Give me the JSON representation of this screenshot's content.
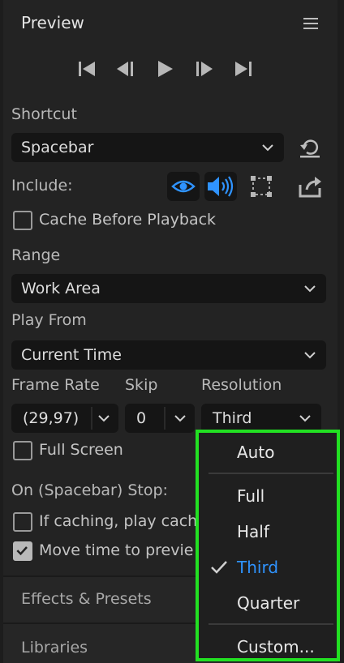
{
  "panel": {
    "title": "Preview"
  },
  "shortcut": {
    "label": "Shortcut",
    "value": "Spacebar"
  },
  "include": {
    "label": "Include:"
  },
  "cache_before_playback": {
    "label": "Cache Before Playback",
    "checked": false
  },
  "range": {
    "label": "Range",
    "value": "Work Area"
  },
  "play_from": {
    "label": "Play From",
    "value": "Current Time"
  },
  "frame_rate": {
    "label": "Frame Rate",
    "value": "(29,97)"
  },
  "skip": {
    "label": "Skip",
    "value": "0"
  },
  "resolution": {
    "label": "Resolution",
    "value": "Third",
    "menu": [
      "Auto",
      "Full",
      "Half",
      "Third",
      "Quarter",
      "Custom..."
    ],
    "selected": "Third"
  },
  "full_screen": {
    "label": "Full Screen",
    "checked": false
  },
  "on_stop": {
    "label": "On (Spacebar) Stop:",
    "if_caching": {
      "label": "If caching, play cach",
      "checked": false
    },
    "move_time": {
      "label": "Move time to previe",
      "checked": true
    }
  },
  "collapsed_panels": [
    "Effects & Presets",
    "Libraries"
  ],
  "colors": {
    "highlight": "#2f93ff",
    "annotation_box": "#22e022"
  }
}
